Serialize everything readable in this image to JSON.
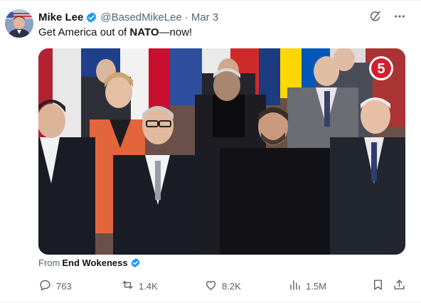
{
  "author": {
    "name": "Mike Lee",
    "handle": "@BasedMikeLee",
    "separator": "·",
    "date": "Mar 3"
  },
  "tweet": {
    "text_before": "Get America out of ",
    "text_bold": "NATO",
    "text_after": "—now!"
  },
  "media": {
    "channel_badge": "5"
  },
  "attribution": {
    "prefix": "From",
    "source": "End Wokeness"
  },
  "actions": {
    "replies": "763",
    "reposts": "1.4K",
    "likes": "8.2K",
    "views": "1.5M"
  },
  "colors": {
    "verified": "#1d9bf0",
    "text_primary": "#0f1419",
    "text_secondary": "#536471"
  },
  "icons": {
    "top_right": [
      "grok-icon",
      "more-icon"
    ],
    "actions": [
      "reply-icon",
      "repost-icon",
      "like-icon",
      "views-icon",
      "bookmark-icon",
      "share-icon"
    ]
  }
}
